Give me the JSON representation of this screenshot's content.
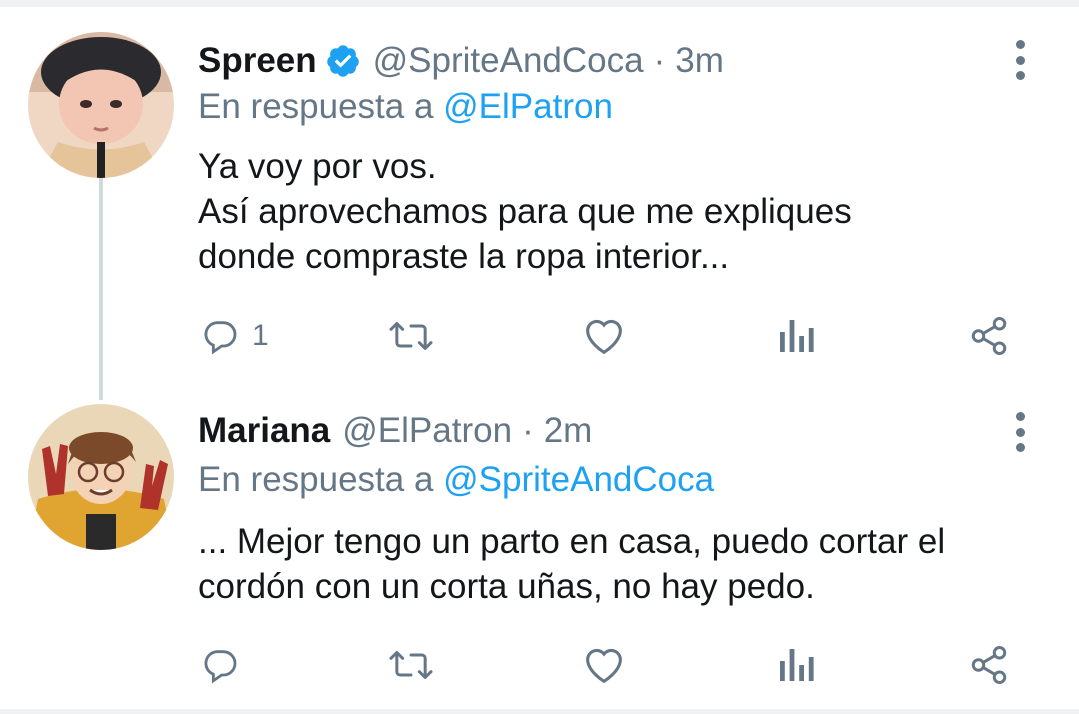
{
  "tweets": [
    {
      "name": "Spreen",
      "verified": true,
      "handle": "@SpriteAndCoca",
      "separator": "·",
      "time": "3m",
      "reply_prefix": "En respuesta a ",
      "reply_to": "@ElPatron",
      "text_lines": [
        "Ya voy por vos.",
        "Así aprovechamos para que me expliques",
        "donde compraste la ropa interior..."
      ],
      "reply_count": "1",
      "avatar_icon": "avatar-illustration-boy"
    },
    {
      "name": "Mariana",
      "verified": false,
      "handle": "@ElPatron",
      "separator": "·",
      "time": "2m",
      "reply_prefix": "En respuesta a ",
      "reply_to": "@SpriteAndCoca",
      "text_lines": [
        "... Mejor tengo un parto en casa, puedo cortar el",
        "cordón con un corta uñas, no hay pedo."
      ],
      "reply_count": "",
      "avatar_icon": "avatar-illustration-peace-sign"
    }
  ],
  "icons": {
    "reply": "reply-icon",
    "retweet": "retweet-icon",
    "like": "heart-icon",
    "stats": "analytics-icon",
    "share": "share-icon",
    "more": "more-vertical-icon",
    "verified": "verified-badge-icon"
  },
  "colors": {
    "text": "#14171a",
    "secondary": "#657786",
    "link": "#1da1f2",
    "verified": "#1da1f2",
    "thread_line": "#cfd9de",
    "divider": "#eff1f3"
  }
}
